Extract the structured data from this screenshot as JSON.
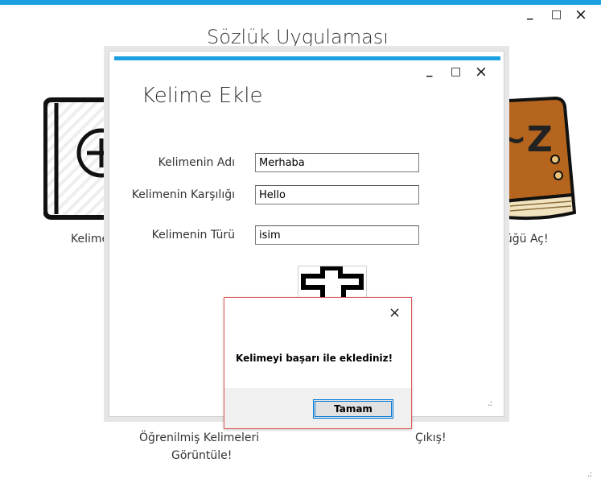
{
  "app": {
    "title": "Sözlük Uygulaması",
    "window_controls": {
      "minimize": "_",
      "maximize": "□",
      "close": "×"
    }
  },
  "tiles": {
    "add_word_label": "Kelime",
    "open_dictionary_label": "lüğü Aç!",
    "learned_words_line1": "Öğrenilmiş Kelimeleri",
    "learned_words_line2": "Görüntüle!",
    "exit_label": "Çıkış!"
  },
  "dialog": {
    "title": "Kelime Ekle",
    "window_controls": {
      "minimize": "_",
      "maximize": "□",
      "close": "×"
    },
    "fields": {
      "word_name_label": "Kelimenin Adı",
      "word_name_value": "Merhaba",
      "word_meaning_label": "Kelimenin Karşılığı",
      "word_meaning_value": "Hello",
      "word_type_label": "Kelimenin Türü",
      "word_type_value": "isim"
    },
    "resize_grip": ".:"
  },
  "message_box": {
    "close": "×",
    "text": "Kelimeyi başarı ile eklediniz!",
    "ok_button": "Tamam"
  },
  "main_resize_grip": ".:",
  "colors": {
    "accent": "#1ba1e2",
    "msgbox_border": "#e05a5a",
    "book_brown": "#b5651d"
  }
}
